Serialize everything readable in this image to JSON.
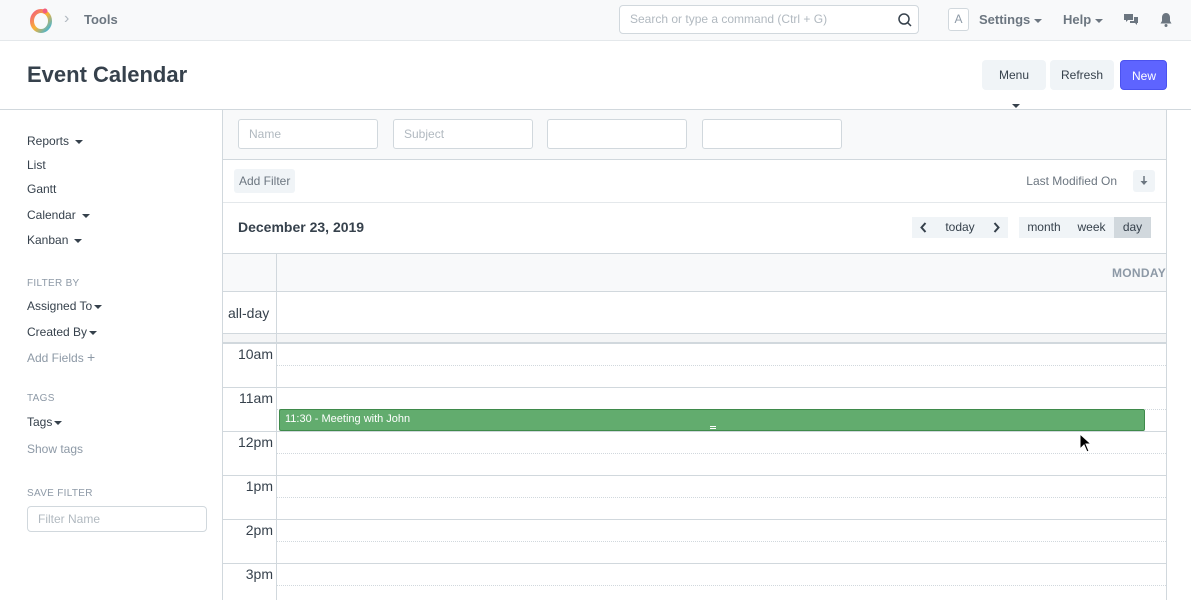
{
  "navbar": {
    "breadcrumb": "Tools",
    "search_placeholder": "Search or type a command (Ctrl + G)",
    "avatar_letter": "A",
    "settings_label": "Settings",
    "help_label": "Help"
  },
  "page": {
    "title": "Event Calendar",
    "menu_label": "Menu",
    "refresh_label": "Refresh",
    "new_label": "New"
  },
  "sidebar": {
    "views": [
      "Reports",
      "List",
      "Gantt",
      "Calendar",
      "Kanban"
    ],
    "filter_by_heading": "FILTER BY",
    "assigned_to": "Assigned To",
    "created_by": "Created By",
    "add_fields": "Add Fields",
    "tags_heading": "TAGS",
    "tags": "Tags",
    "show_tags": "Show tags",
    "save_filter_heading": "SAVE FILTER",
    "filter_name_placeholder": "Filter Name"
  },
  "filters": {
    "name_placeholder": "Name",
    "subject_placeholder": "Subject",
    "add_filter": "Add Filter",
    "sort_label": "Last Modified On"
  },
  "calendar": {
    "date": "December 23, 2019",
    "today_label": "today",
    "month_label": "month",
    "week_label": "week",
    "day_label": "day",
    "active_view": "day",
    "day_header": "MONDAY",
    "allday_label": "all-day",
    "time_labels": [
      "10am",
      "11am",
      "12pm",
      "1pm",
      "2pm",
      "3pm"
    ],
    "event": {
      "time": "11:30",
      "title": "Meeting with John",
      "color": "#62ac6e"
    }
  },
  "colors": {
    "primary": "#5e64ff",
    "event_green": "#62ac6e"
  }
}
